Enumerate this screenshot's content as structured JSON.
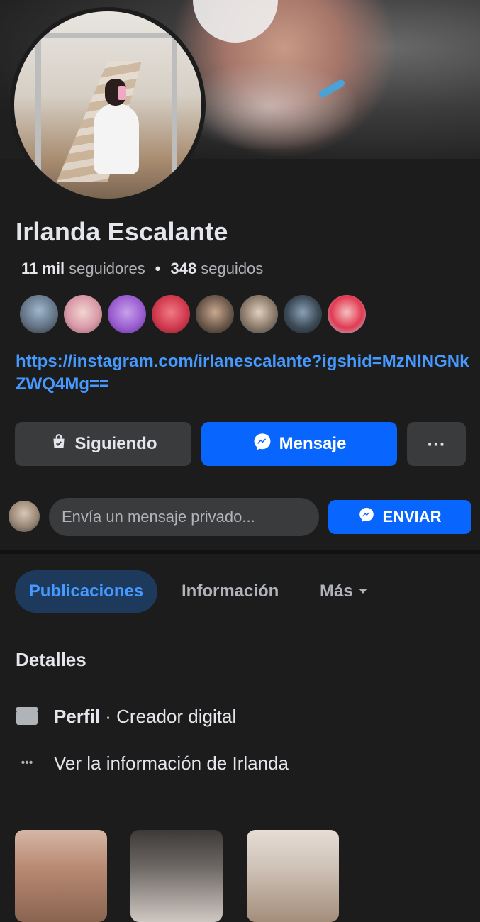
{
  "profile": {
    "name": "Irlanda Escalante",
    "followers_count": "11 mil",
    "followers_label": "seguidores",
    "separator": "•",
    "following_count": "348",
    "following_label": "seguidos",
    "link": "https://instagram.com/irlanescalante?igshid=MzNlNGNkZWQ4Mg=="
  },
  "mutual_avatars": [
    {
      "icon": "avatar-1"
    },
    {
      "icon": "avatar-2"
    },
    {
      "icon": "avatar-3"
    },
    {
      "icon": "avatar-4"
    },
    {
      "icon": "avatar-5"
    },
    {
      "icon": "avatar-6"
    },
    {
      "icon": "avatar-7"
    },
    {
      "icon": "avatar-8"
    }
  ],
  "actions": {
    "following_label": "Siguiendo",
    "message_label": "Mensaje",
    "more_label": "···"
  },
  "private_message": {
    "placeholder": "Envía un mensaje privado...",
    "send_label": "ENVIAR"
  },
  "tabs": [
    {
      "label": "Publicaciones",
      "active": true
    },
    {
      "label": "Información",
      "active": false
    },
    {
      "label": "Más",
      "active": false
    }
  ],
  "details": {
    "title": "Detalles",
    "profile_label": "Perfil",
    "profile_value": " · Creador digital",
    "see_info": "Ver la información de Irlanda",
    "dots_icon": "•••"
  },
  "colors": {
    "background": "#1c1c1d",
    "accent": "#0866ff",
    "link": "#4599ff",
    "tab_active_bg": "#1d3a5d"
  }
}
